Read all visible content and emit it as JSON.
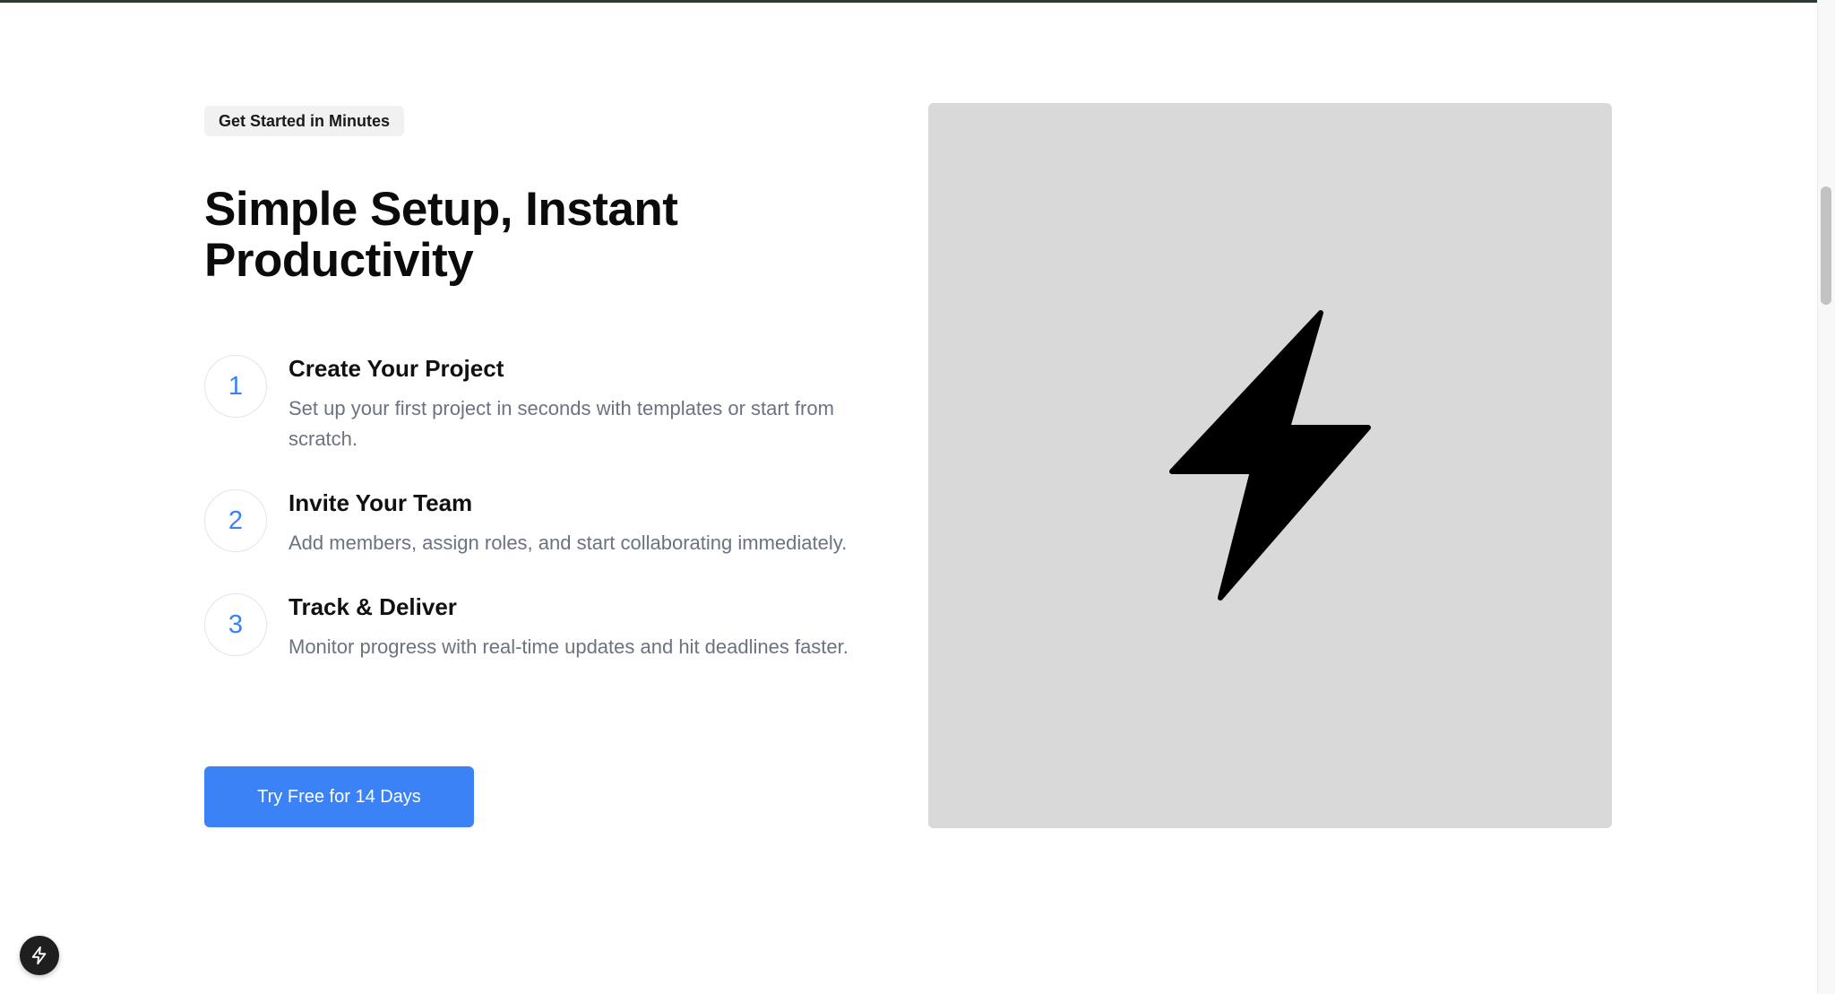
{
  "badge": "Get Started in Minutes",
  "headline": "Simple Setup, Instant Productivity",
  "steps": [
    {
      "number": "1",
      "title": "Create Your Project",
      "description": "Set up your first project in seconds with templates or start from scratch."
    },
    {
      "number": "2",
      "title": "Invite Your Team",
      "description": "Add members, assign roles, and start collaborating immediately."
    },
    {
      "number": "3",
      "title": "Track & Deliver",
      "description": "Monitor progress with real-time updates and hit deadlines faster."
    }
  ],
  "cta": {
    "label": "Try Free for 14 Days"
  },
  "media": {
    "icon": "lightning-bolt-icon"
  },
  "fab": {
    "icon": "lightning-bolt-icon"
  },
  "colors": {
    "accent": "#3b82f6",
    "muted_text": "#6b7280",
    "media_background": "#d9d9d9"
  }
}
